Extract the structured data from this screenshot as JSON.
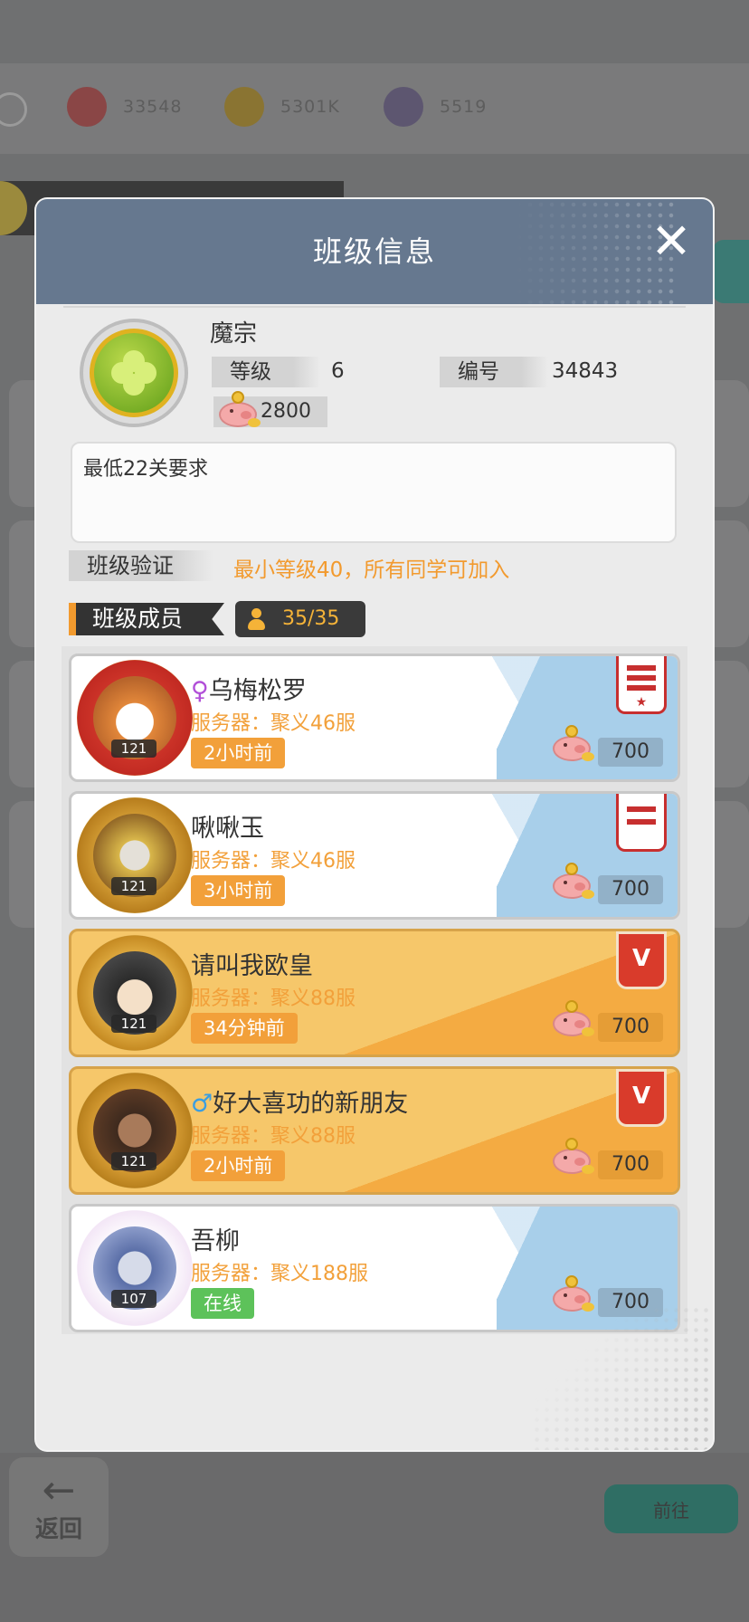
{
  "background": {
    "resources": [
      {
        "icon": "red-gem-icon",
        "value": "33548"
      },
      {
        "icon": "gold-coin-icon",
        "value": "5301K"
      },
      {
        "icon": "crystal-ball-icon",
        "value": "5519"
      }
    ],
    "back_label": "返回",
    "right_button_label": "前往"
  },
  "dialog": {
    "title": "班级信息",
    "close_icon": "close-icon",
    "class_info": {
      "name": "魔宗",
      "level_label": "等级",
      "level_value": "6",
      "id_label": "编号",
      "id_value": "34843",
      "funds": "2800",
      "description": "最低22关要求"
    },
    "verification": {
      "label": "班级验证",
      "text": "最小等级40，所有同学可加入"
    },
    "members_header": {
      "label": "班级成员",
      "count": "35/35"
    },
    "members": [
      {
        "gender": "♀",
        "name": "乌梅松罗",
        "server": "服务器：聚义46服",
        "time": "2小时前",
        "level": "121",
        "contribution": "700",
        "badge": "leader",
        "style": "white"
      },
      {
        "gender": "",
        "name": "啾啾玉",
        "server": "服务器：聚义46服",
        "time": "3小时前",
        "level": "121",
        "contribution": "700",
        "badge": "vice-leader",
        "style": "white"
      },
      {
        "gender": "",
        "name": "请叫我欧皇",
        "server": "服务器：聚义88服",
        "time": "34分钟前",
        "level": "121",
        "contribution": "700",
        "badge": "elite",
        "style": "gold"
      },
      {
        "gender": "♂",
        "name": "好大喜功的新朋友",
        "server": "服务器：聚义88服",
        "time": "2小时前",
        "level": "121",
        "contribution": "700",
        "badge": "elite",
        "style": "gold"
      },
      {
        "gender": "",
        "name": "吾柳",
        "server": "服务器：聚义188服",
        "time": "在线",
        "level": "107",
        "contribution": "700",
        "badge": "",
        "style": "white"
      }
    ]
  },
  "colors": {
    "header": "#66788f",
    "accent_orange": "#f2a03a",
    "online_green": "#5dc25a",
    "badge_red": "#c72f2f"
  }
}
